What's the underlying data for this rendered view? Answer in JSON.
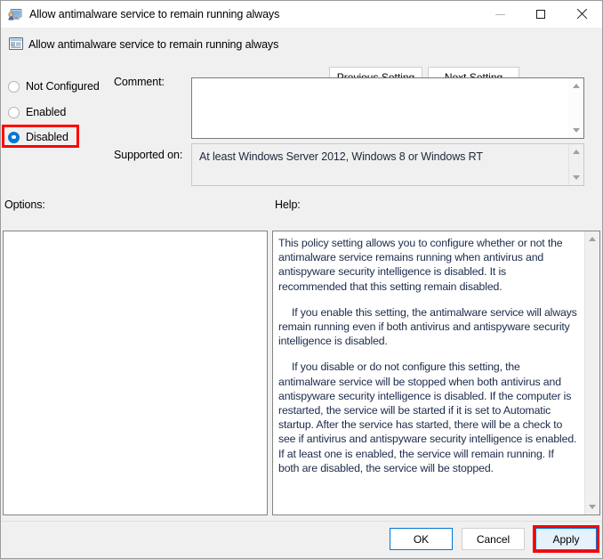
{
  "window": {
    "title": "Allow antimalware service to remain running always",
    "icon": "policy-monitor-icon",
    "controls": {
      "minimize": "minimize-icon",
      "maximize": "maximize-icon",
      "close": "close-icon"
    }
  },
  "header": {
    "icon": "group-policy-setting-icon",
    "policy_name": "Allow antimalware service to remain running always",
    "previous_setting_label": "Previous Setting",
    "next_setting_label": "Next Setting"
  },
  "state": {
    "options": [
      {
        "label": "Not Configured",
        "selected": false
      },
      {
        "label": "Enabled",
        "selected": false
      },
      {
        "label": "Disabled",
        "selected": true
      }
    ],
    "highlighted_option": "Disabled"
  },
  "comment": {
    "label": "Comment:",
    "value": "",
    "placeholder": ""
  },
  "supported_on": {
    "label": "Supported on:",
    "value": "At least Windows Server 2012, Windows 8 or Windows RT"
  },
  "options_panel": {
    "label": "Options:",
    "content": ""
  },
  "help_panel": {
    "label": "Help:",
    "paragraphs": [
      "This policy setting allows you to configure whether or not the antimalware service remains running when antivirus and antispyware security intelligence is disabled. It is recommended that this setting remain disabled.",
      "If you enable this setting, the antimalware service will always remain running even if both antivirus and antispyware security intelligence is disabled.",
      "If you disable or do not configure this setting, the antimalware service will be stopped when both antivirus and antispyware security intelligence is disabled. If the computer is restarted, the service will be started if it is set to Automatic startup. After the service has started, there will be a check to see if antivirus and antispyware security intelligence is enabled. If at least one is enabled, the service will remain running. If both are disabled, the service will be stopped."
    ]
  },
  "footer": {
    "ok_label": "OK",
    "cancel_label": "Cancel",
    "apply_label": "Apply",
    "highlighted_button": "Apply"
  },
  "colors": {
    "accent": "#0078d7",
    "highlight": "#ff0000",
    "window_bg": "#f0f0f0",
    "panel_bg": "#ffffff",
    "help_text": "#1a2a4a"
  }
}
